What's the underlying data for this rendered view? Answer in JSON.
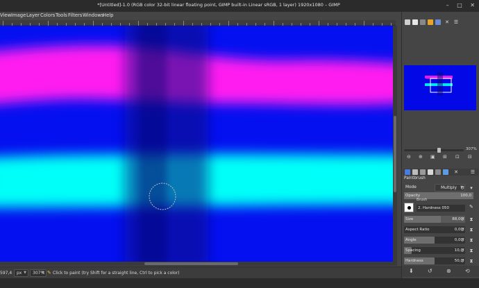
{
  "window": {
    "title": "*[Untitled]-1.0 (RGB color 32-bit linear floating point, GIMP built-in Linear sRGB, 1 layer) 1920x1080 – GIMP",
    "buttons": [
      "–",
      "□",
      "✕"
    ]
  },
  "menu": [
    {
      "key": "view",
      "label": "View"
    },
    {
      "key": "image",
      "label": "Image"
    },
    {
      "key": "layer",
      "label": "Layer"
    },
    {
      "key": "colors",
      "label": "Colors"
    },
    {
      "key": "tools",
      "label": "Tools"
    },
    {
      "key": "filters",
      "label": "Filters"
    },
    {
      "key": "windows",
      "label": "Windows"
    },
    {
      "key": "help",
      "label": "Help"
    }
  ],
  "statusbar": {
    "coords": "597,4",
    "unit": "px",
    "zoom": "307%",
    "message": "Click to paint (try Shift for a straight line, Ctrl to pick a color)"
  },
  "navigator": {
    "zoom": "307%"
  },
  "tool_options": {
    "title": "Paintbrush",
    "mode_label": "Mode",
    "mode_value": "Multiply",
    "opacity_label": "Opacity",
    "opacity_value": "100,0",
    "opacity_fraction": 1.0,
    "brush_label": "Brush",
    "brush_name": "2. Hardness 050",
    "rows": [
      {
        "label": "Size",
        "value": "88,00"
      },
      {
        "label": "Aspect Ratio",
        "value": "0,00"
      },
      {
        "label": "Angle",
        "value": "0,00"
      },
      {
        "label": "Spacing",
        "value": "10,0"
      },
      {
        "label": "Hardness",
        "value": "50,0"
      }
    ]
  },
  "colors": {
    "canvas_base": "#0410f0",
    "magenta_band": "#ff1ef0",
    "cyan_band": "#00fff8",
    "dark_band": "#0a0880"
  }
}
